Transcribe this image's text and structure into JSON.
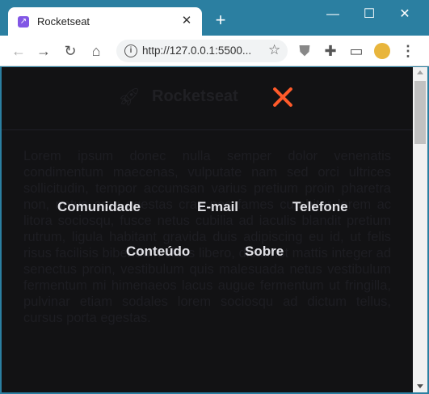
{
  "tab": {
    "title": "Rocketseat",
    "favicon": "rocketseat-favicon",
    "close": "✕"
  },
  "window": {
    "new_tab": "+",
    "minimize": "—",
    "maximize": "☐",
    "close": "✕"
  },
  "toolbar": {
    "url": "http://127.0.0.1:5500...",
    "back": "←",
    "forward": "→",
    "reload": "↻",
    "home": "⌂",
    "star": "☆",
    "menu": "⋮"
  },
  "page": {
    "logo_text": "Rocketseat",
    "body_text": "Lorem ipsum donec nulla semper dolor venenatis condimentum maecenas, vulputate nam sed orci ultrices sollicitudin, tempor accumsan varius pretium proin pharetra non, netus arcu egestas cras nec fames curabitur lorem ac litora sociosqu, fusce netus cubilia ad iaculis blandit pretium rutrum, ligula habitant gravida duis adipiscing eu id, ut felis risus facilisis bibendum class libero, dictumst mattis integer ad senectus proin, vestibulum quis malesuada netus vestibulum fermentum mi himenaeos lacus augue fermentum ut fringilla, pulvinar etiam sodales lorem sociosqu ad dictum tellus, cursus porta egestas.",
    "nav": [
      "Comunidade",
      "E-mail",
      "Telefone",
      "Conteúdo",
      "Sobre"
    ]
  },
  "colors": {
    "accent_close": "#ff5a2a",
    "menu_bg": "#121214",
    "link": "#e1e1e6"
  }
}
